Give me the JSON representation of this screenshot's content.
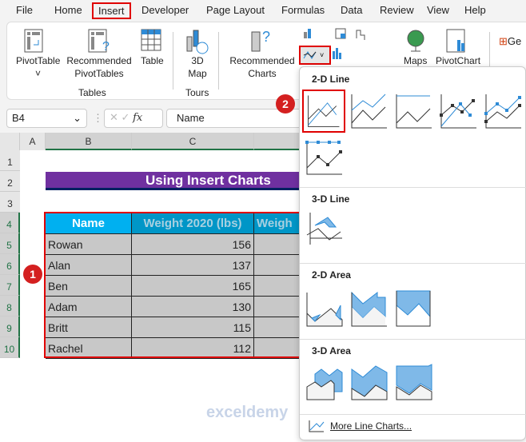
{
  "menu": {
    "tabs": [
      "File",
      "Home",
      "Insert",
      "Developer",
      "Page Layout",
      "Formulas",
      "Data",
      "Review",
      "View",
      "Help"
    ],
    "active": "Insert"
  },
  "ribbon": {
    "pivottable": "PivotTable",
    "rec_pivot_1": "Recommended",
    "rec_pivot_2": "PivotTables",
    "table": "Table",
    "map_1": "3D",
    "map_2": "Map",
    "rec_charts_1": "Recommended",
    "rec_charts_2": "Charts",
    "maps": "Maps",
    "pivotchart": "PivotChart",
    "get": "Ge",
    "group_tables": "Tables",
    "group_tours": "Tours"
  },
  "formula": {
    "name_box": "B4",
    "fx": "fx",
    "value": "Name"
  },
  "columns": [
    "A",
    "B",
    "C"
  ],
  "rows": [
    "1",
    "2",
    "3",
    "4",
    "5",
    "6",
    "7",
    "8",
    "9",
    "10"
  ],
  "sheet": {
    "title": "Using Insert Charts",
    "headers": [
      "Name",
      "Weight 2020 (lbs)",
      "Weigh"
    ],
    "data": [
      [
        "Rowan",
        "156"
      ],
      [
        "Alan",
        "137"
      ],
      [
        "Ben",
        "165"
      ],
      [
        "Adam",
        "130"
      ],
      [
        "Britt",
        "115"
      ],
      [
        "Rachel",
        "112"
      ]
    ]
  },
  "badges": [
    "1",
    "2"
  ],
  "dropdown": {
    "sections": [
      "2-D Line",
      "3-D Line",
      "2-D Area",
      "3-D Area"
    ],
    "more": "More Line Charts..."
  },
  "watermark": "exceldemy",
  "colors": {
    "accent": "#2e8bd6",
    "highlight": "#e00000",
    "title_bg": "#7030a0",
    "header_bg": "#00b0f0"
  }
}
